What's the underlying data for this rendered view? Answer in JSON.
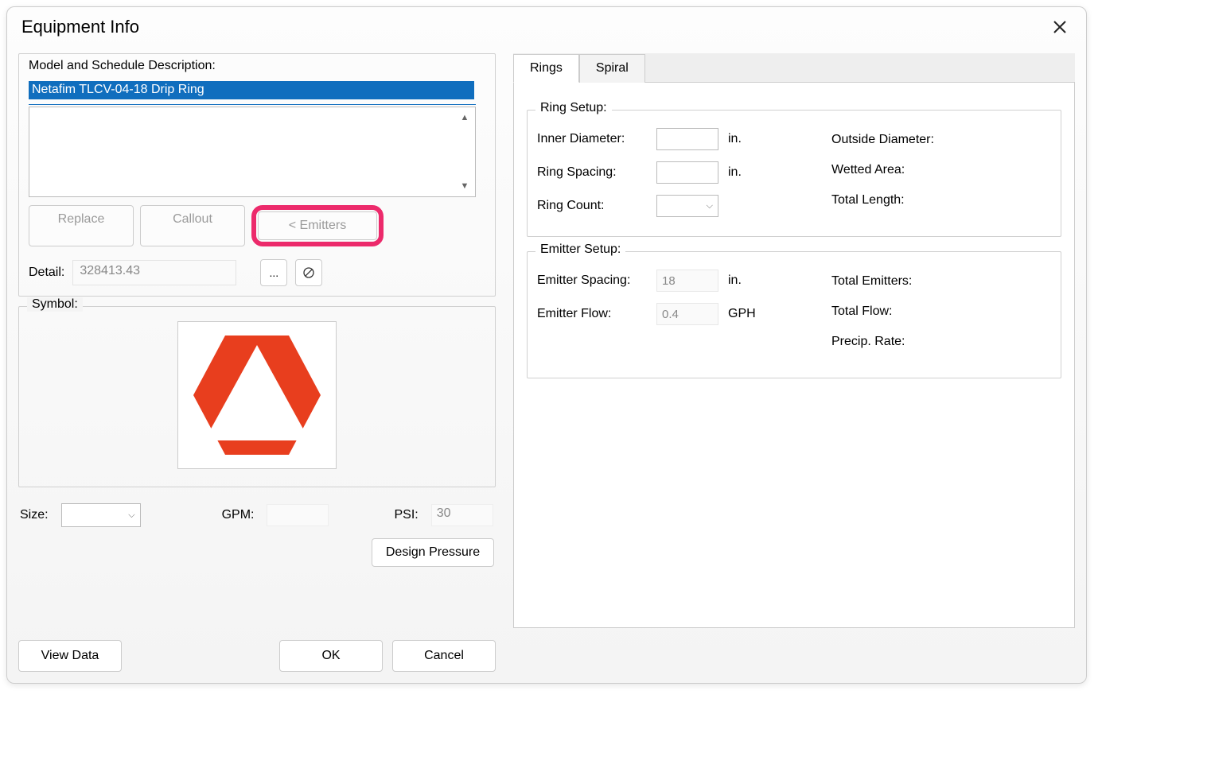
{
  "dialog": {
    "title": "Equipment Info"
  },
  "left": {
    "model_label": "Model and Schedule Description:",
    "model_value": "Netafim TLCV-04-18 Drip Ring",
    "replace_btn": "Replace",
    "callout_btn": "Callout",
    "emitters_btn": "< Emitters",
    "detail_label": "Detail:",
    "detail_value": "328413.43",
    "ellipsis_btn": "...",
    "symbol_label": "Symbol:",
    "size_label": "Size:",
    "gpm_label": "GPM:",
    "psi_label": "PSI:",
    "psi_value": "30",
    "design_pressure_btn": "Design Pressure",
    "view_data_btn": "View Data",
    "ok_btn": "OK",
    "cancel_btn": "Cancel"
  },
  "tabs": {
    "rings": "Rings",
    "spiral": "Spiral"
  },
  "ring_setup": {
    "legend": "Ring Setup:",
    "inner_diameter_label": "Inner Diameter:",
    "inner_diameter_value": "",
    "inner_diameter_unit": "in.",
    "ring_spacing_label": "Ring Spacing:",
    "ring_spacing_value": "",
    "ring_spacing_unit": "in.",
    "ring_count_label": "Ring Count:",
    "outside_diameter_label": "Outside Diameter:",
    "wetted_area_label": "Wetted Area:",
    "total_length_label": "Total Length:"
  },
  "emitter_setup": {
    "legend": "Emitter Setup:",
    "emitter_spacing_label": "Emitter Spacing:",
    "emitter_spacing_value": "18",
    "emitter_spacing_unit": "in.",
    "emitter_flow_label": "Emitter Flow:",
    "emitter_flow_value": "0.4",
    "emitter_flow_unit": "GPH",
    "total_emitters_label": "Total Emitters:",
    "total_flow_label": "Total Flow:",
    "precip_rate_label": "Precip. Rate:"
  }
}
